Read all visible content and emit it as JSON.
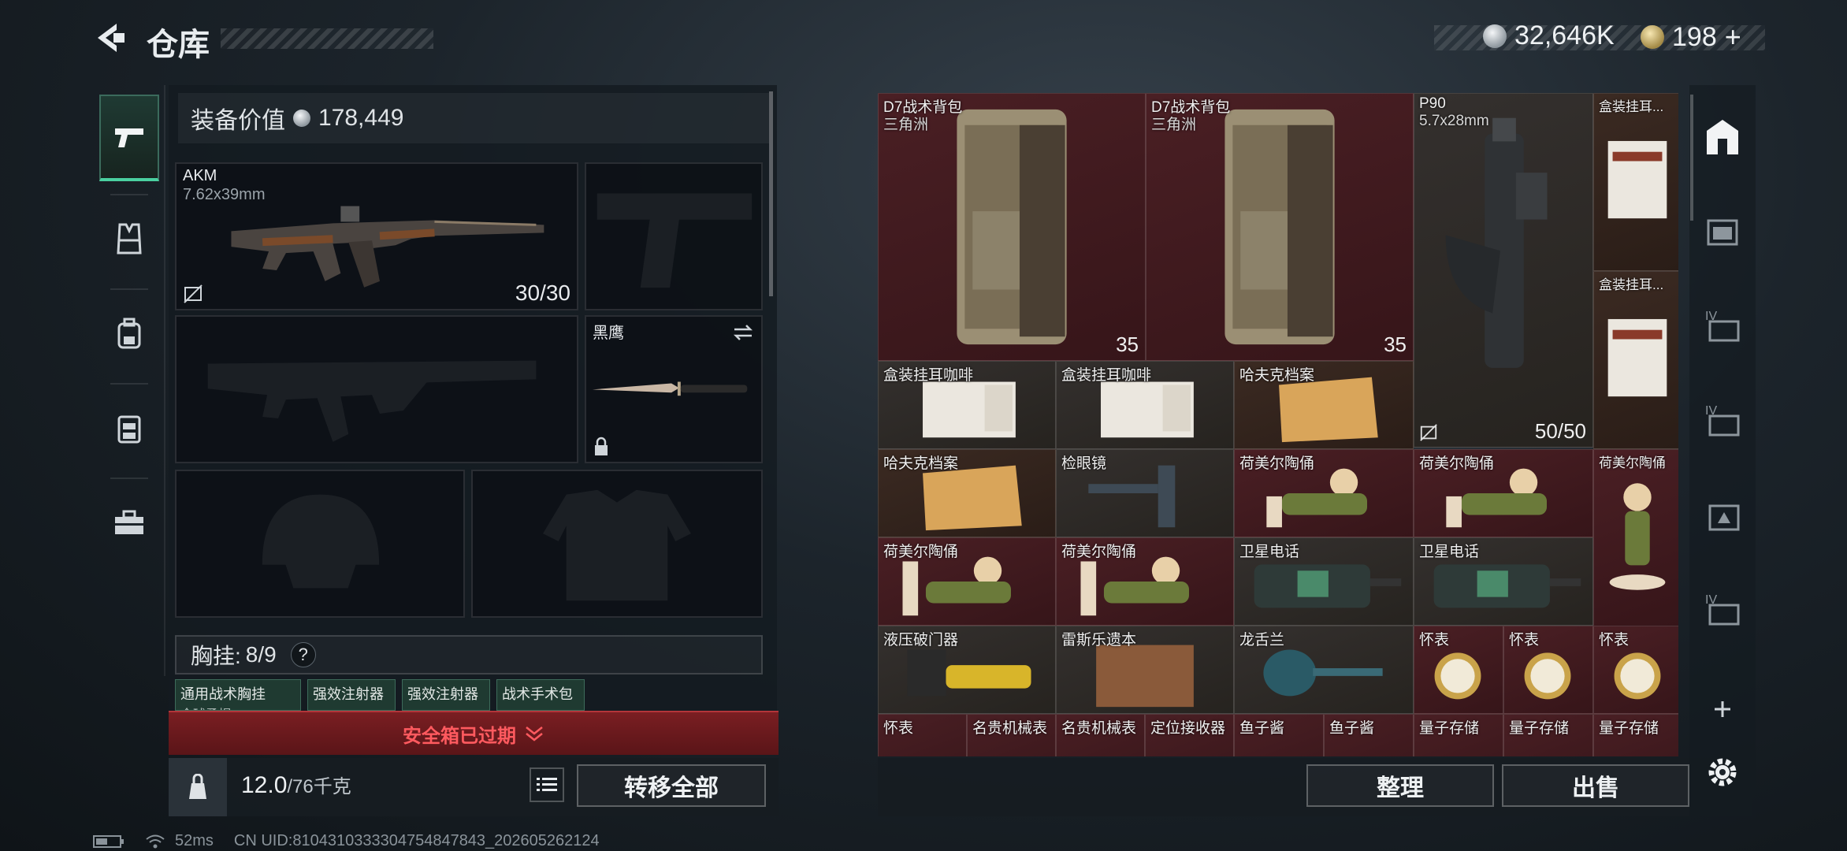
{
  "header": {
    "title": "仓库",
    "currencies": [
      {
        "icon": "silver-coin-icon",
        "value": "32,646K"
      },
      {
        "icon": "gold-coin-icon",
        "value": "198",
        "add": "+"
      }
    ]
  },
  "left_tabs": [
    "pistol-icon",
    "armor-vest-icon",
    "backpack-icon",
    "chest-rig-icon",
    "toolbox-icon"
  ],
  "loadout": {
    "equip_value_label": "装备价值",
    "equip_value": "178,449",
    "primary": {
      "name": "AKM",
      "caliber": "7.62x39mm",
      "ammo": "30/30"
    },
    "melee": {
      "name": "黑鹰"
    },
    "chest_rig": {
      "label": "胸挂:",
      "count": "8/9",
      "help": "?"
    },
    "chest_items": [
      "通用战术胸挂",
      "强效注射器",
      "强效注射器",
      "战术手术包"
    ],
    "chest_item_sub": "全球勇帽",
    "safe_box": "安全箱已过期",
    "weight": "12.0",
    "weight_max": "/76千克",
    "transfer_all": "转移全部"
  },
  "stash": {
    "items": [
      {
        "name": "D7战术背包",
        "sub": "三角洲",
        "count": "35"
      },
      {
        "name": "D7战术背包",
        "sub": "三角洲",
        "count": "35"
      },
      {
        "name": "P90",
        "sub": "5.7x28mm",
        "count": "50/50"
      },
      {
        "name": "盒装挂耳..."
      },
      {
        "name": "盒装挂耳..."
      },
      {
        "name": "盒装挂耳咖啡"
      },
      {
        "name": "盒装挂耳咖啡"
      },
      {
        "name": "哈夫克档案"
      },
      {
        "name": "哈夫克档案"
      },
      {
        "name": "检眼镜"
      },
      {
        "name": "荷美尔陶俑"
      },
      {
        "name": "荷美尔陶俑"
      },
      {
        "name": "荷美尔陶俑"
      },
      {
        "name": "荷美尔陶俑"
      },
      {
        "name": "荷美尔陶俑"
      },
      {
        "name": "卫星电话"
      },
      {
        "name": "卫星电话"
      },
      {
        "name": "液压破门器"
      },
      {
        "name": "雷斯乐遗本"
      },
      {
        "name": "龙舌兰"
      },
      {
        "name": "怀表"
      },
      {
        "name": "怀表"
      },
      {
        "name": "怀表"
      },
      {
        "name": "怀表"
      },
      {
        "name": "名贵机械表"
      },
      {
        "name": "名贵机械表"
      },
      {
        "name": "定位接收器"
      },
      {
        "name": "鱼子酱"
      },
      {
        "name": "鱼子酱"
      },
      {
        "name": "量子存储"
      },
      {
        "name": "量子存储"
      },
      {
        "name": "量子存储"
      }
    ],
    "sort_button": "整理",
    "sell_button": "出售"
  },
  "side_icons": [
    "safe-house-icon",
    "folder-icon",
    "level-iv-icon",
    "level-iv-icon",
    "level-triangle-icon",
    "level-iv-icon",
    "add-icon",
    "settings-icon"
  ],
  "status": {
    "ping": "52ms",
    "uid": "CN UID:8104310333304754847843_202605262124"
  },
  "colors": {
    "accent": "#4ad0a0",
    "alert": "#ff5a5f",
    "alert_bg": "#6a1a1d"
  }
}
